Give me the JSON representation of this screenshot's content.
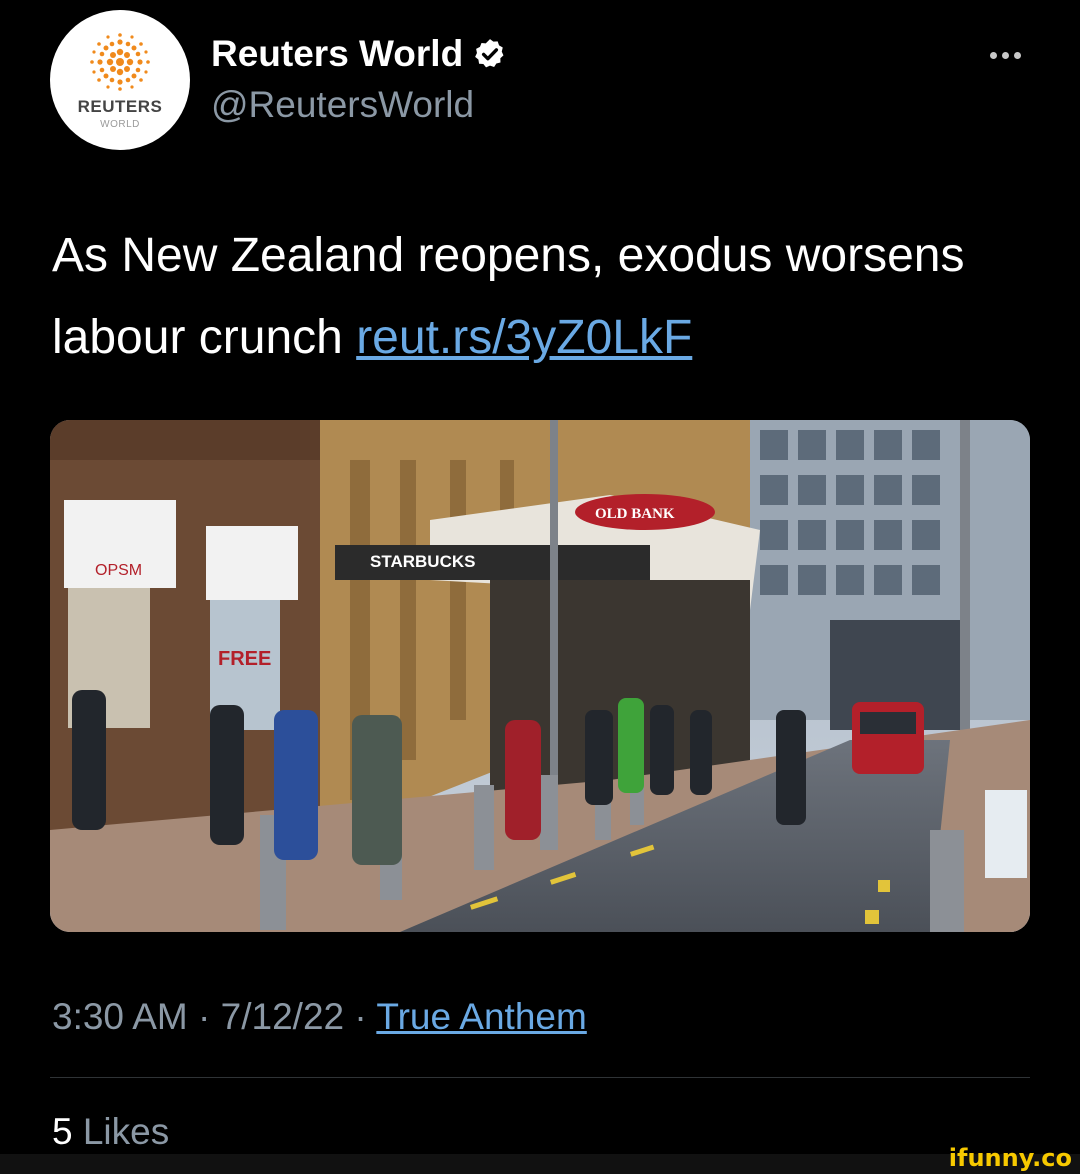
{
  "account": {
    "display_name": "Reuters World",
    "handle": "@ReutersWorld",
    "avatar_title": "REUTERS",
    "avatar_subtitle": "WORLD",
    "verified": true
  },
  "tweet": {
    "text": "As New Zealand reopens, exodus worsens labour crunch",
    "link": "reut.rs/3yZ0LkF"
  },
  "media": {
    "storefront_sign": "STARBUCKS",
    "arcade_sign": "OLD BANK",
    "shop_sign": "OPSM",
    "poster_text": "FREE",
    "accent_red": "#b3202a"
  },
  "meta": {
    "time": "3:30 AM",
    "date": "7/12/22",
    "source": "True Anthem",
    "separator": "·"
  },
  "stats": {
    "likes_count": "5",
    "likes_label": "Likes"
  },
  "watermark": "ifunny.co"
}
